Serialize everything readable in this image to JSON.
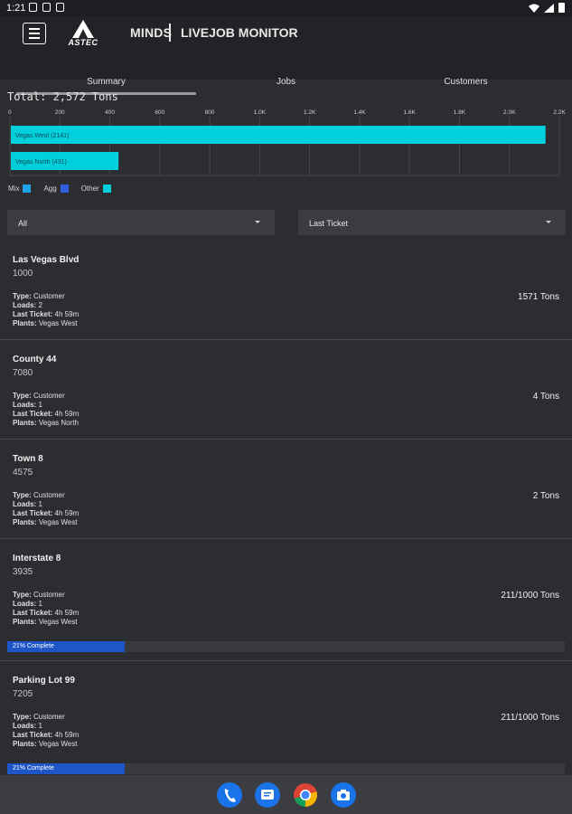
{
  "status": {
    "time": "1:21"
  },
  "appbar": {
    "logo_text": "ASTEC",
    "brand": "MINDS",
    "title": "LIVEJOB MONITOR"
  },
  "tabs": [
    {
      "label": "Summary",
      "selected": true
    },
    {
      "label": "Jobs",
      "selected": false
    },
    {
      "label": "Customers",
      "selected": false
    }
  ],
  "summary": {
    "total": "Total: 2,572 Tons"
  },
  "chart_data": {
    "type": "bar",
    "orientation": "horizontal",
    "categories": [
      "Vegas West (2141)",
      "Vegas North (431)"
    ],
    "values": [
      2141,
      431
    ],
    "xlim": [
      0,
      2200
    ],
    "xticks": [
      0,
      200,
      400,
      600,
      800,
      1000,
      1200,
      1400,
      1600,
      1800,
      2000,
      2200
    ],
    "xtick_labels": [
      "0",
      "200",
      "400",
      "600",
      "800",
      "1.0K",
      "1.2K",
      "1.4K",
      "1.6K",
      "1.8K",
      "2.0K",
      "2.2K"
    ],
    "bar_color": "#00d0dc",
    "grid": true,
    "legend": [
      {
        "label": "Mix",
        "color": "#1fa3e8"
      },
      {
        "label": "Agg",
        "color": "#2f5fe0"
      },
      {
        "label": "Other",
        "color": "#00d0dc"
      }
    ],
    "legend_position": "bottom-left"
  },
  "filters": {
    "left": "All",
    "right": "Last Ticket"
  },
  "jobs": [
    {
      "name": "Las Vegas Blvd",
      "number": "1000",
      "type_label": "Type:",
      "type": "Customer",
      "loads_label": "Loads:",
      "loads": "2",
      "last_label": "Last Ticket:",
      "last": "4h 59m",
      "plants_label": "Plants:",
      "plants": "Vegas West",
      "tons": "1571 Tons"
    },
    {
      "name": "County 44",
      "number": "7080",
      "type_label": "Type:",
      "type": "Customer",
      "loads_label": "Loads:",
      "loads": "1",
      "last_label": "Last Ticket:",
      "last": "4h 59m",
      "plants_label": "Plants:",
      "plants": "Vegas North",
      "tons": "4 Tons"
    },
    {
      "name": "Town 8",
      "number": "4575",
      "type_label": "Type:",
      "type": "Customer",
      "loads_label": "Loads:",
      "loads": "1",
      "last_label": "Last Ticket:",
      "last": "4h 59m",
      "plants_label": "Plants:",
      "plants": "Vegas West",
      "tons": "2 Tons"
    },
    {
      "name": "Interstate 8",
      "number": "3935",
      "type_label": "Type:",
      "type": "Customer",
      "loads_label": "Loads:",
      "loads": "1",
      "last_label": "Last Ticket:",
      "last": "4h 59m",
      "plants_label": "Plants:",
      "plants": "Vegas West",
      "tons": "211/1000 Tons",
      "progress_label": "21% Complete",
      "progress": 0.21
    },
    {
      "name": "Parking Lot 99",
      "number": "7205",
      "type_label": "Type:",
      "type": "Customer",
      "loads_label": "Loads:",
      "loads": "1",
      "last_label": "Last Ticket:",
      "last": "4h 59m",
      "plants_label": "Plants:",
      "plants": "Vegas West",
      "tons": "211/1000 Tons",
      "progress_label": "21% Complete",
      "progress": 0.21
    }
  ],
  "dock": [
    {
      "name": "phone-app-icon",
      "color": "#1a73e8"
    },
    {
      "name": "messages-app-icon",
      "color": "#1a73e8"
    },
    {
      "name": "chrome-app-icon",
      "color": "#ffffff"
    },
    {
      "name": "camera-app-icon",
      "color": "#1a73e8"
    }
  ]
}
